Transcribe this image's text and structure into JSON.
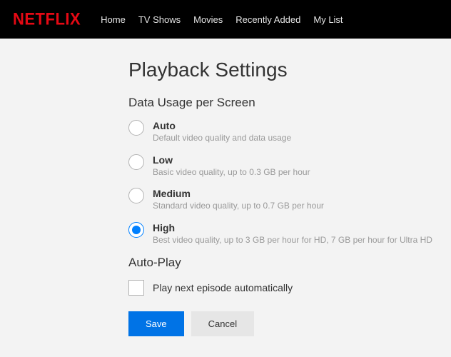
{
  "brand": "NETFLIX",
  "nav": {
    "items": [
      "Home",
      "TV Shows",
      "Movies",
      "Recently Added",
      "My List"
    ]
  },
  "page": {
    "title": "Playback Settings",
    "data_usage": {
      "heading": "Data Usage per Screen",
      "options": [
        {
          "label": "Auto",
          "desc": "Default video quality and data usage",
          "checked": false
        },
        {
          "label": "Low",
          "desc": "Basic video quality, up to 0.3 GB per hour",
          "checked": false
        },
        {
          "label": "Medium",
          "desc": "Standard video quality, up to 0.7 GB per hour",
          "checked": false
        },
        {
          "label": "High",
          "desc": "Best video quality, up to 3 GB per hour for HD, 7 GB per hour for Ultra HD",
          "checked": true
        }
      ]
    },
    "autoplay": {
      "heading": "Auto-Play",
      "checkbox_label": "Play next episode automatically",
      "checked": false
    },
    "buttons": {
      "save": "Save",
      "cancel": "Cancel"
    }
  }
}
